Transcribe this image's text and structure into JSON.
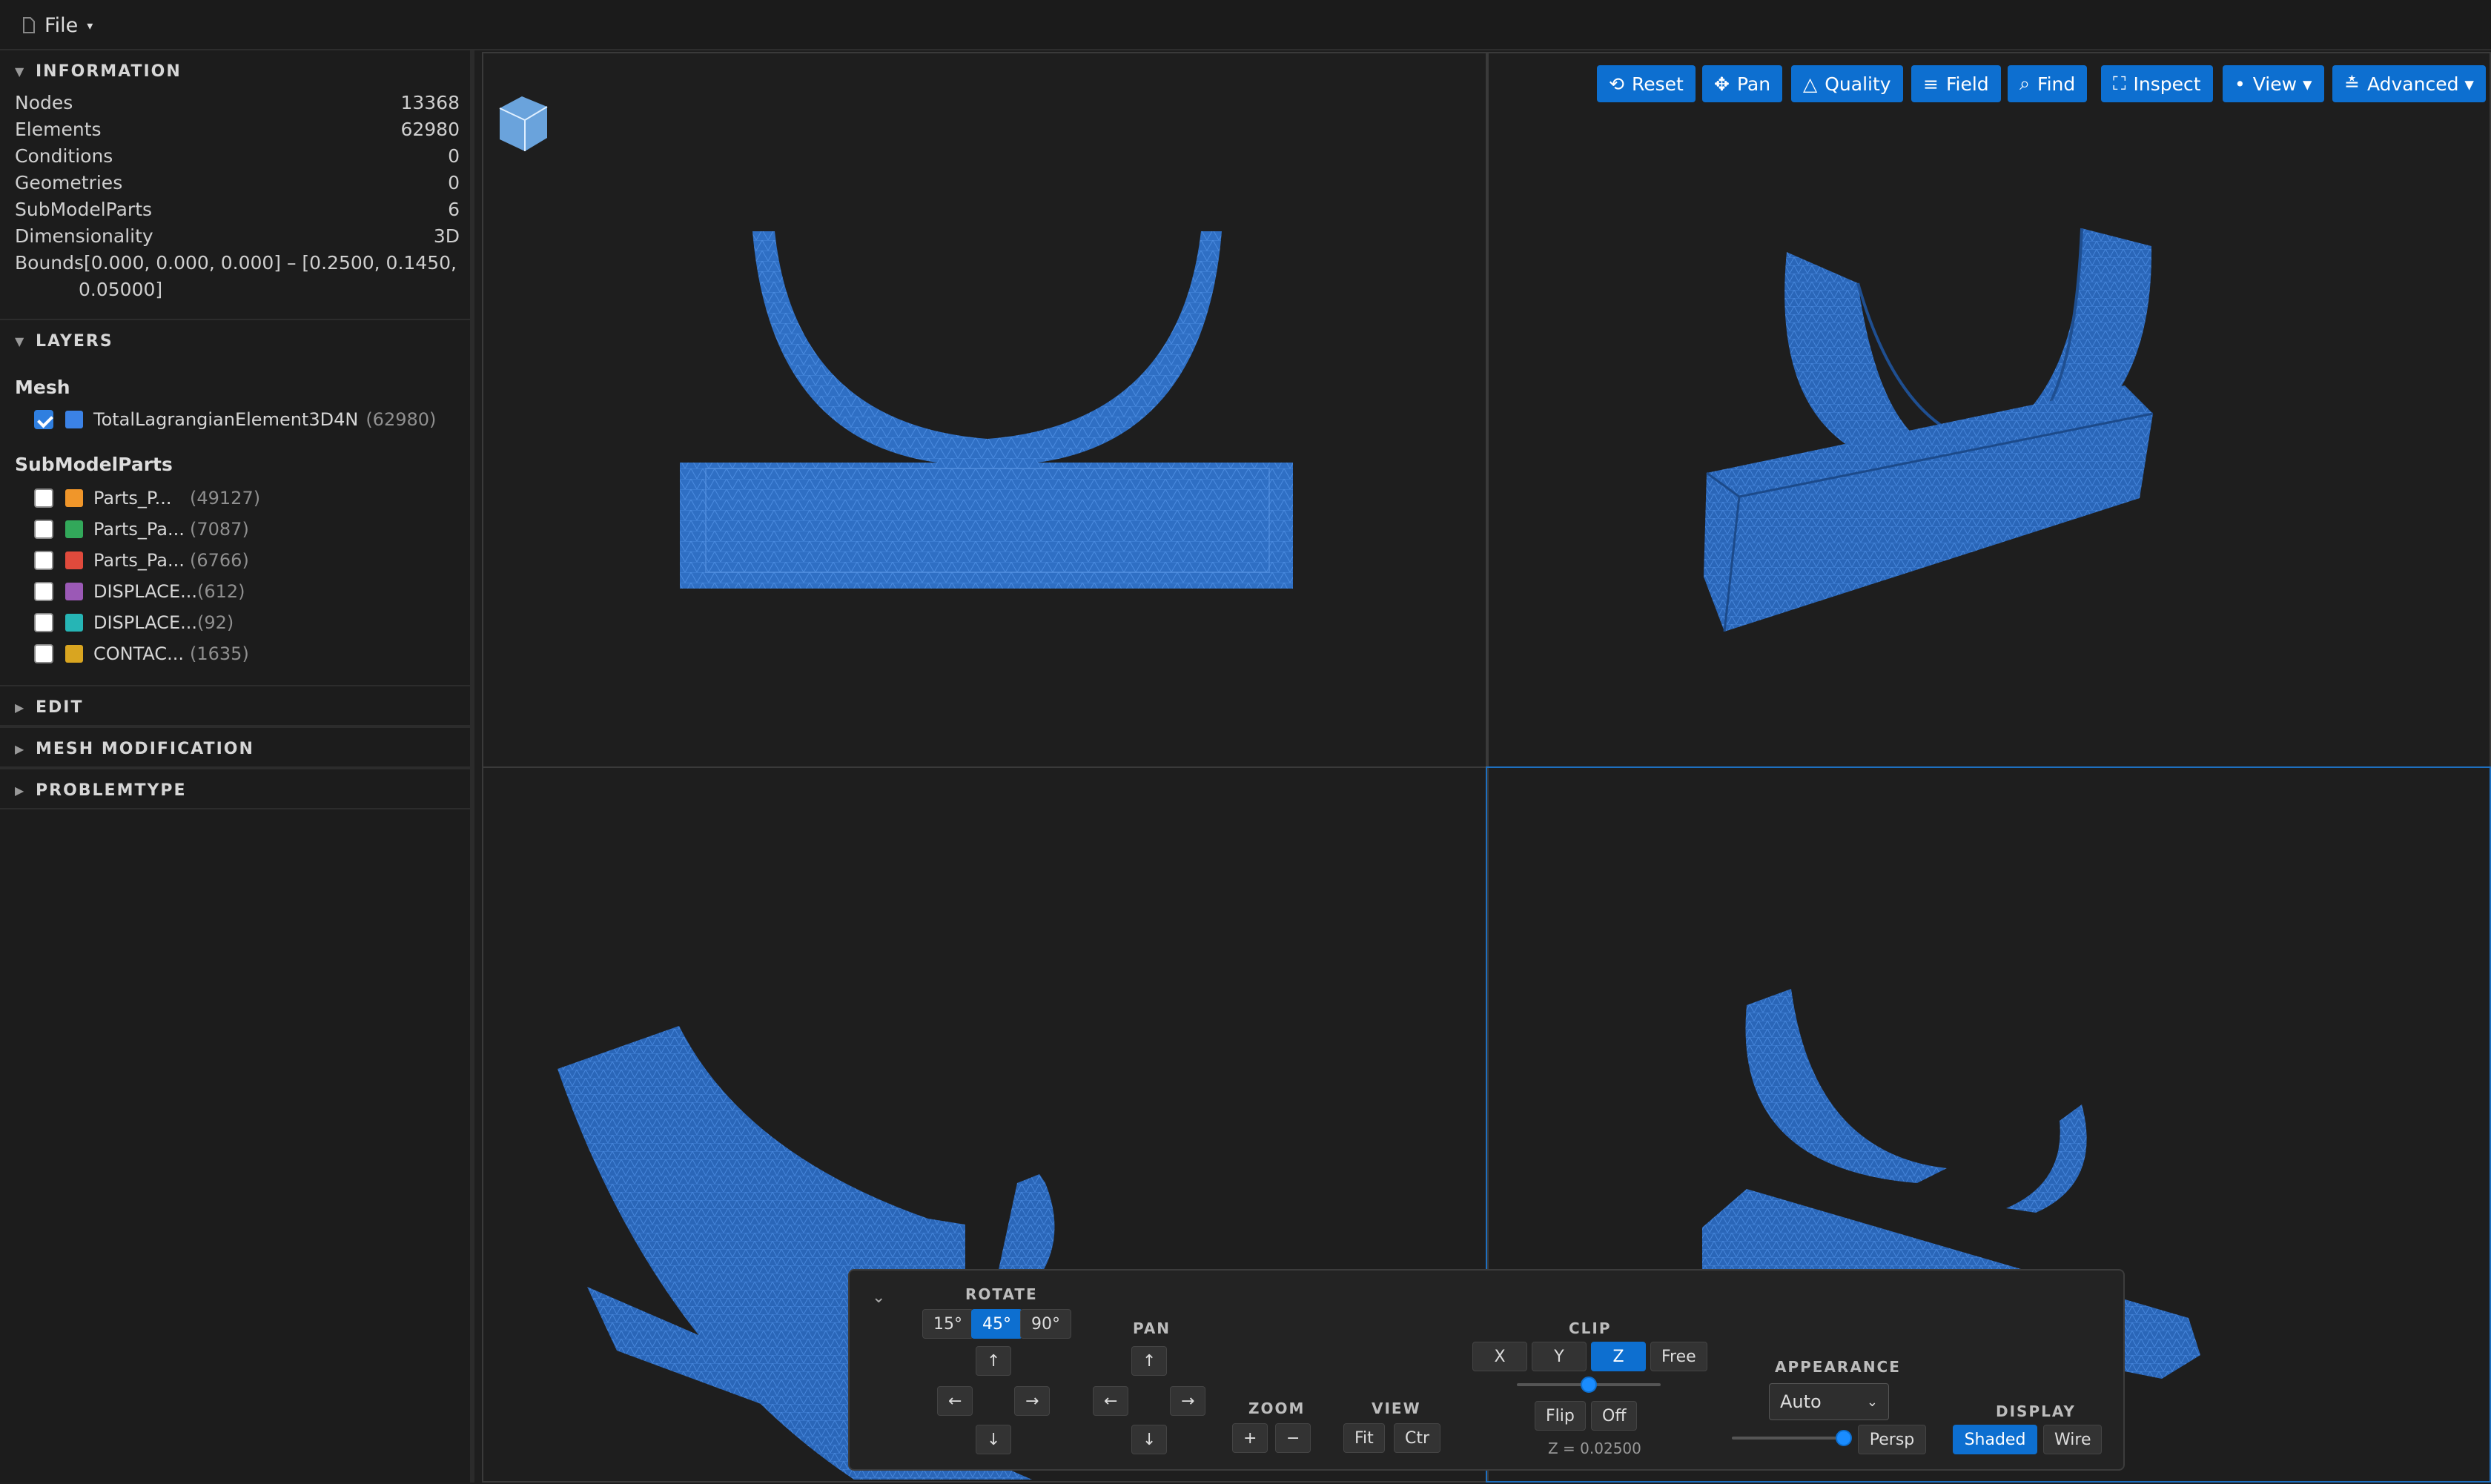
{
  "menubar": {
    "file_label": "File"
  },
  "info": {
    "title": "INFORMATION",
    "rows": [
      {
        "label": "Nodes",
        "value": "13368"
      },
      {
        "label": "Elements",
        "value": "62980"
      },
      {
        "label": "Conditions",
        "value": "0"
      },
      {
        "label": "Geometries",
        "value": "0"
      },
      {
        "label": "SubModelParts",
        "value": "6"
      },
      {
        "label": "Dimensionality",
        "value": "3D"
      }
    ],
    "bounds_label": "Bounds",
    "bounds_line1": "[0.000, 0.000, 0.000] – [0.2500, 0.1450,",
    "bounds_line2": "0.05000]"
  },
  "layers": {
    "title": "LAYERS",
    "mesh_label": "Mesh",
    "mesh_item": {
      "name": "TotalLagrangianElement3D4N",
      "count": "(62980)",
      "color": "#3b82e6",
      "checked": true
    },
    "submodel_label": "SubModelParts",
    "submodel_items": [
      {
        "name": "Parts_P...",
        "count": "(49127)",
        "color": "#f0962a"
      },
      {
        "name": "Parts_Pa...",
        "count": "(7087)",
        "color": "#32a85a"
      },
      {
        "name": "Parts_Pa...",
        "count": "(6766)",
        "color": "#e04a3c"
      },
      {
        "name": "DISPLACE...",
        "count": "(612)",
        "color": "#9b59b6"
      },
      {
        "name": "DISPLACE...",
        "count": "(92)",
        "color": "#26b5b5"
      },
      {
        "name": "CONTAC...",
        "count": "(1635)",
        "color": "#d9a520"
      }
    ]
  },
  "sections": {
    "edit": "EDIT",
    "mesh_mod": "MESH MODIFICATION",
    "problemtype": "PROBLEMTYPE"
  },
  "toolbar": {
    "reset": "Reset",
    "pan": "Pan",
    "quality": "Quality",
    "field": "Field",
    "find": "Find",
    "inspect": "Inspect",
    "view": "View ▾",
    "advanced": "Advanced ▾"
  },
  "controls": {
    "rotate_label": "ROTATE",
    "rot15": "15°",
    "rot45": "45°",
    "rot90": "90°",
    "pan_label": "PAN",
    "zoom_label": "ZOOM",
    "zoom_in": "+",
    "zoom_out": "−",
    "view_label": "VIEW",
    "fit": "Fit",
    "ctr": "Ctr",
    "clip_label": "CLIP",
    "clip_x": "X",
    "clip_y": "Y",
    "clip_z": "Z",
    "clip_free": "Free",
    "flip": "Flip",
    "off": "Off",
    "clip_value": "Z = 0.02500",
    "appearance_label": "APPEARANCE",
    "appearance_option": "Auto",
    "persp": "Persp",
    "display_label": "DISPLAY",
    "shaded": "Shaded",
    "wire": "Wire",
    "arrow_up": "↑",
    "arrow_down": "↓",
    "arrow_left": "←",
    "arrow_right": "→",
    "collapse": "⌄"
  },
  "colors": {
    "mesh": "#2f6fc4",
    "accent": "#0d6fd0"
  }
}
